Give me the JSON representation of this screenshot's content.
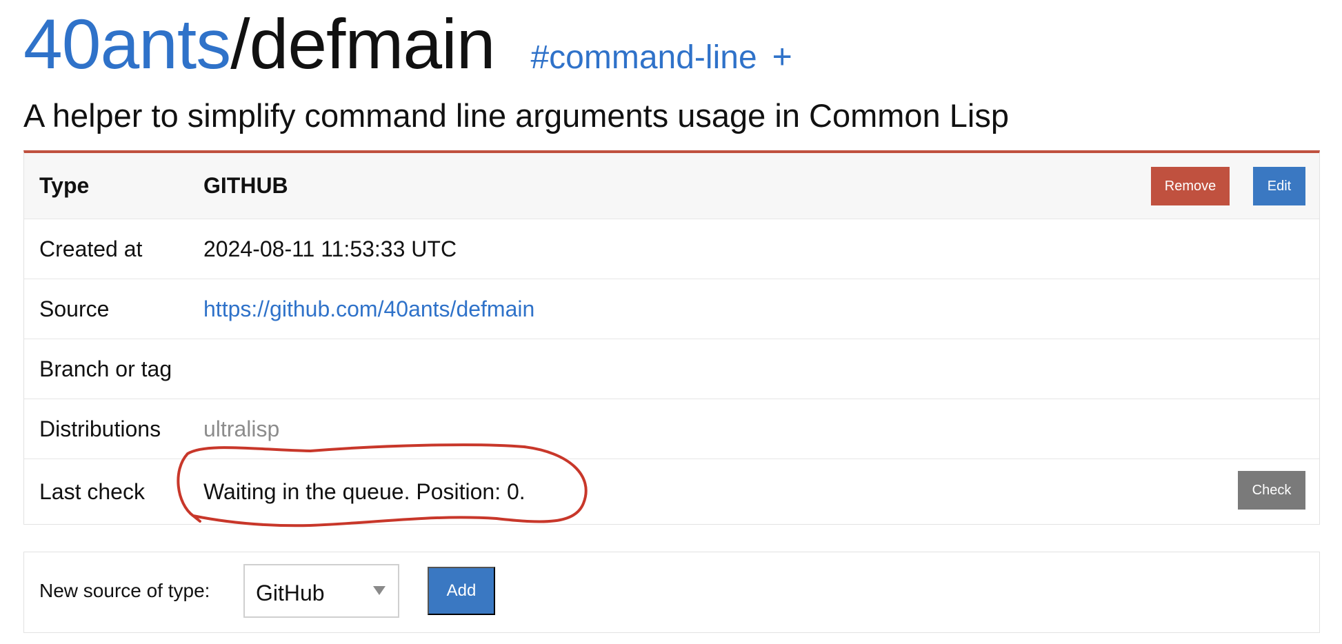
{
  "header": {
    "owner": "40ants",
    "separator": "/",
    "project": "defmain",
    "tag": "#command-line",
    "add_tag": "+"
  },
  "description": "A helper to simplify command line arguments usage in Common Lisp",
  "info": {
    "type_label": "Type",
    "type_value": "GITHUB",
    "remove_label": "Remove",
    "edit_label": "Edit",
    "created_label": "Created at",
    "created_value": "2024-08-11 11:53:33 UTC",
    "source_label": "Source",
    "source_value": "https://github.com/40ants/defmain",
    "branch_label": "Branch or tag",
    "branch_value": "",
    "distributions_label": "Distributions",
    "distributions_value": "ultralisp",
    "last_check_label": "Last check",
    "last_check_value": "Waiting in the queue. Position: 0.",
    "check_label": "Check"
  },
  "new_source": {
    "label": "New source of type:",
    "selected": "GitHub",
    "add_label": "Add"
  },
  "colors": {
    "accent_blue": "#2f72c9",
    "danger_red": "#c0513f",
    "annotation_red": "#c8372a",
    "neutral_gray": "#7a7a7a"
  },
  "icons": {
    "select_caret": "chevron-down-icon"
  }
}
